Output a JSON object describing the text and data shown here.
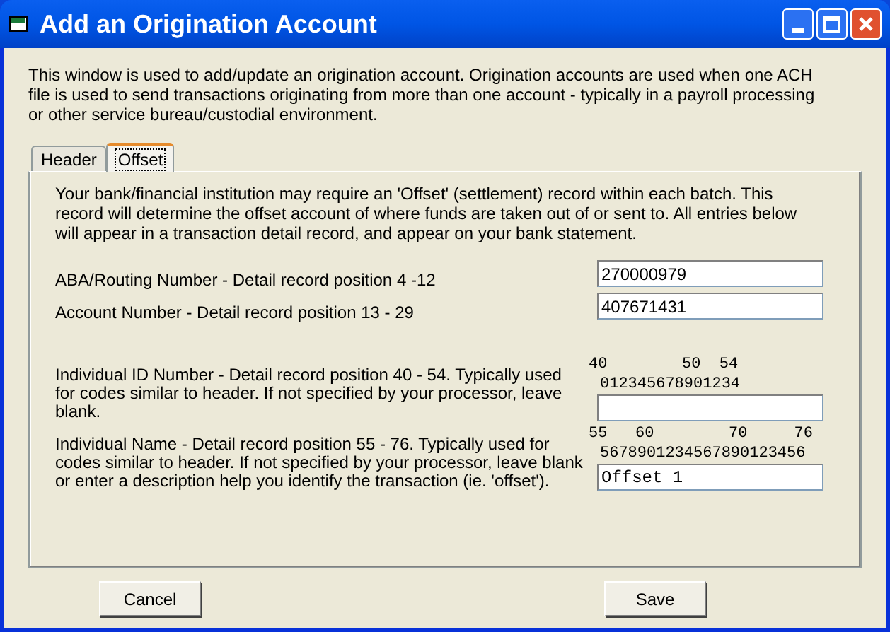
{
  "window": {
    "title": "Add an Origination Account"
  },
  "intro": "This window is used to add/update an origination account.  Origination accounts are used when one ACH file is used to send transactions originating from more than one account - typically in a payroll processing or other service bureau/custodial environment.",
  "tabs": [
    {
      "label": "Header",
      "selected": false
    },
    {
      "label": "Offset",
      "selected": true
    }
  ],
  "panel": {
    "description": "Your bank/financial institution may require an 'Offset' (settlement) record within each batch.  This record will determine the offset account of where funds are taken out of or sent to.  All entries below will appear in a transaction detail record, and appear on your bank statement.",
    "fields": [
      {
        "label": "ABA/Routing Number - Detail record position 4 -12",
        "value": "270000979"
      },
      {
        "label": "Account Number - Detail record position 13 - 29",
        "value": "407671431"
      },
      {
        "label": "Individual ID Number - Detail record position 40 - 54.  Typically used for codes similar to header.  If not specified by your processor, leave blank.",
        "ruler_numbers": "40        50  54",
        "ruler_digits": "012345678901234"
      },
      {
        "label": "Individual Name - Detail record position 55 - 76.  Typically used for codes similar to header.  If not specified by your processor, leave blank or enter a description help you identify the transaction (ie. 'offset').",
        "ruler_numbers": "55   60        70     76",
        "ruler_digits": "5678901234567890123456",
        "value": "Offset 1"
      }
    ]
  },
  "buttons": [
    "Cancel",
    "Save"
  ]
}
